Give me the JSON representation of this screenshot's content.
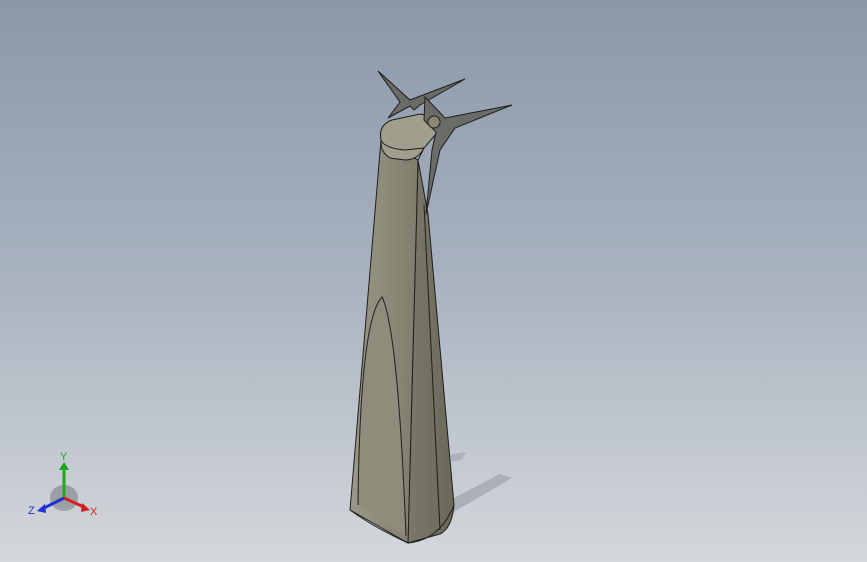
{
  "viewport": {
    "model": "wind-turbine-tower",
    "colors": {
      "background_top": "#8a98aa",
      "background_bottom": "#d4d7db",
      "model_face": "#8c8a78",
      "model_face_light": "#a3a190",
      "model_face_dark": "#6f6d5e",
      "edge": "#1e1e1e",
      "blade": "#6b6b68",
      "shadow": "#9da3ab"
    }
  },
  "triad": {
    "x_label": "X",
    "y_label": "Y",
    "z_label": "Z",
    "colors": {
      "x": "#d22020",
      "y": "#1fa81f",
      "z": "#2030d0"
    }
  }
}
